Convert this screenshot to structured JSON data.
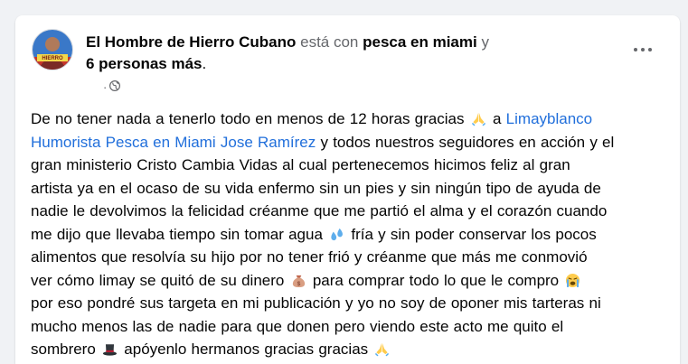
{
  "post": {
    "author": "El Hombre de Hierro Cubano",
    "is_with": "está con",
    "tagged_place": "pesca en miami",
    "and_word": "y",
    "others": "6 personas más",
    "period": ".",
    "meta_dot": "·",
    "privacy_icon": "globe-icon",
    "more_icon": "more-options-icon",
    "avatar_badge": "HIERRO"
  },
  "body": {
    "l1a": "De no tener nada a tenerlo todo en menos de 12 horas gracias",
    "e1": "folded-hands-emoji",
    "l1b": "a",
    "link1": "Limayblanco",
    "link2": "Humorista Pesca en Miami",
    "link3": "Jose Ramírez",
    "l2": "y todos nuestros seguidores en acción y el",
    "l3": "gran ministerio Cristo Cambia Vidas al cual pertenecemos hicimos feliz al gran",
    "l4": "artista ya en el ocaso de su vida enfermo sin un pies y sin ningún tipo de ayuda de",
    "l5": "nadie le devolvimos la felicidad créanme que me partió el alma y el corazón cuando",
    "l6a": "me dijo que llevaba tiempo sin tomar agua",
    "e2": "sweat-droplets-emoji",
    "l6b": "fría y sin poder conservar los pocos",
    "l7": "alimentos que resolvía su hijo por no tener frió y créanme que más me conmovió",
    "l8a": "ver cómo limay se quitó de su dinero",
    "e3": "money-bag-emoji",
    "l8b": "para comprar todo lo que le compro",
    "e4": "crying-face-emoji",
    "l9": "por eso pondré sus targeta en mi publicación y yo no soy de oponer mis tarteras ni",
    "l10": "mucho menos las de nadie para que donen pero viendo este acto me quito el",
    "l11a": "sombrero",
    "e5": "top-hat-emoji",
    "l11b": "apóyenlo hermanos gracias gracias",
    "e6": "folded-hands-emoji"
  },
  "colors": {
    "link": "#216fdb",
    "text": "#050505",
    "secondary": "#65676b",
    "card_bg": "#ffffff",
    "page_bg": "#f0f2f5"
  }
}
